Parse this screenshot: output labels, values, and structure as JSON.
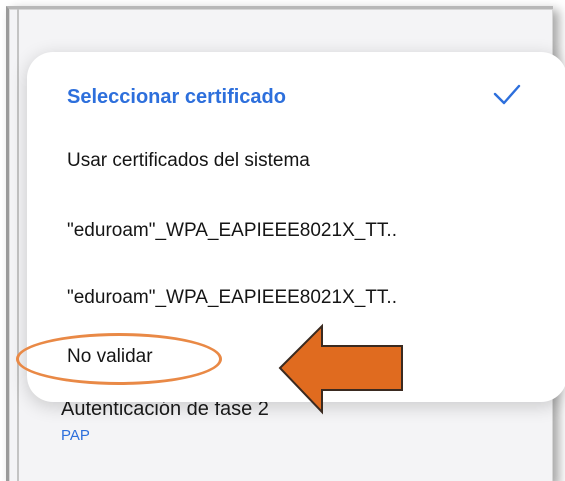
{
  "popup": {
    "title": "Seleccionar certificado",
    "selected_icon": "check-icon",
    "options": [
      "Usar certificados del sistema",
      "\"eduroam\"_WPA_EAPIEEE8021X_TT..",
      "\"eduroam\"_WPA_EAPIEEE8021X_TT..",
      "No validar"
    ]
  },
  "background_setting": {
    "title": "Autenticación de fase 2",
    "value": "PAP"
  },
  "annotation": {
    "target": "No validar",
    "ellipse_color": "#e98946",
    "arrow_color": "#e06b1f",
    "arrow_icon": "left-arrow-icon"
  },
  "colors": {
    "accent": "#2d6fdc",
    "text": "#151515",
    "popup_bg": "#ffffff"
  }
}
